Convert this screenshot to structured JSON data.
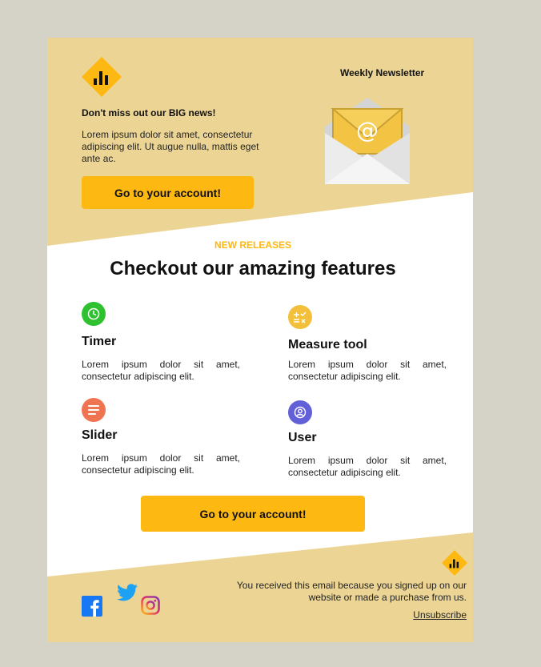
{
  "header": {
    "newsletter_title": "Weekly Newsletter",
    "headline": "Don't miss out our BIG news!",
    "intro": "Lorem ipsum dolor sit amet, consectetur adipiscing elit. Ut augue nulla, mattis eget ante ac.",
    "cta_label": "Go to your account!"
  },
  "features_section": {
    "label": "NEW RELEASES",
    "title": "Checkout our amazing features",
    "items": [
      {
        "name": "Timer",
        "description": "Lorem ipsum dolor sit amet, consectetur adipiscing elit.",
        "icon": "clock-icon",
        "color": "#2fc12f"
      },
      {
        "name": "Measure tool",
        "description": "Lorem ipsum dolor sit amet, consectetur adipiscing elit.",
        "icon": "measure-tool-icon",
        "color": "#f3c03c"
      },
      {
        "name": "Slider",
        "description": "Lorem ipsum dolor sit amet, consectetur adipiscing elit.",
        "icon": "slider-lines-icon",
        "color": "#ef7551"
      },
      {
        "name": "User",
        "description": "Lorem ipsum dolor sit amet, consectetur adipiscing elit.",
        "icon": "user-icon",
        "color": "#6260d8"
      }
    ],
    "cta_label": "Go to your account!"
  },
  "footer": {
    "notice": "You received this email because you signed up on our website or made a purchase from us.",
    "unsubscribe_label": "Unsubscribe",
    "social": [
      "facebook-icon",
      "twitter-icon",
      "instagram-icon"
    ]
  },
  "colors": {
    "page_background": "#d5d3c8",
    "header_background": "#ecd594",
    "accent": "#fdb812",
    "card_background": "#ffffff"
  }
}
